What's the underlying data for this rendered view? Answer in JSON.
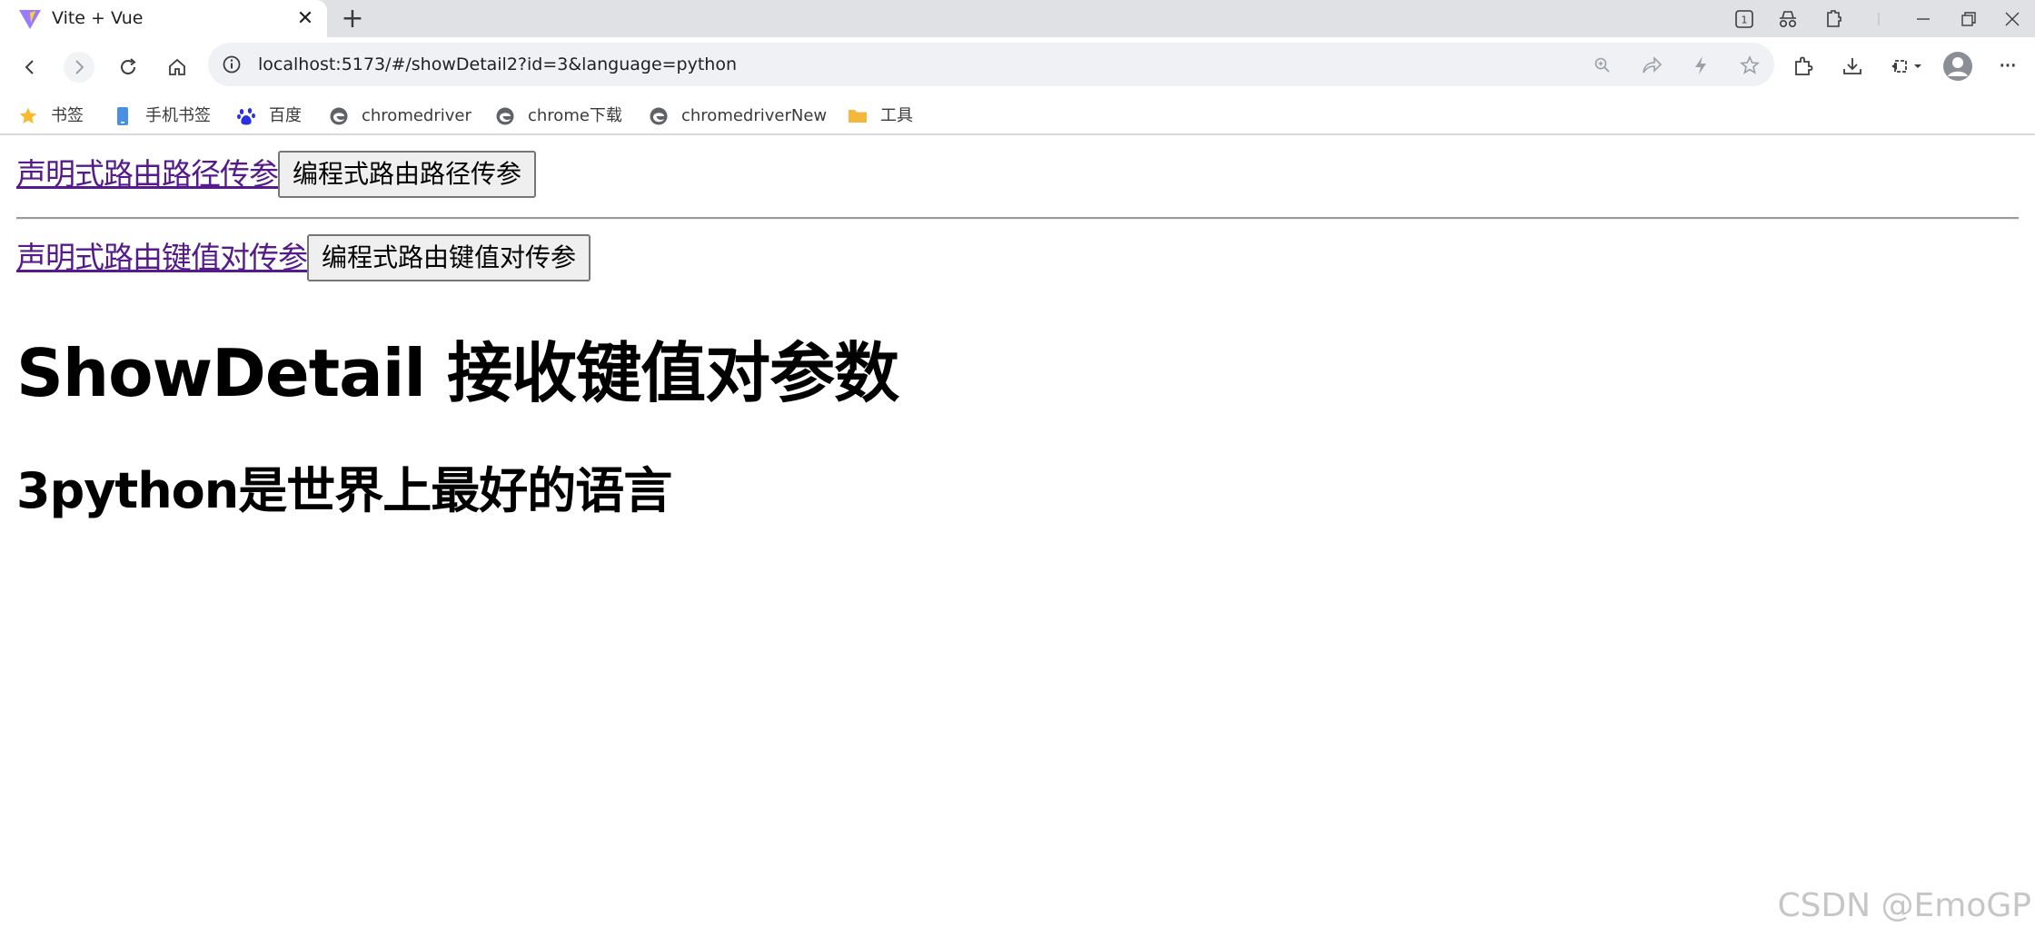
{
  "browser": {
    "tab": {
      "title": "Vite + Vue",
      "close_glyph": "✕"
    },
    "new_tab_glyph": "+",
    "window_controls": [
      "tab-count-icon",
      "incognito-icon",
      "extensions-icon",
      "minimize-icon",
      "restore-icon",
      "close-window-icon"
    ],
    "tab_count": "1",
    "url": "localhost:5173/#/showDetail2?id=3&language=python",
    "more_glyph": "···"
  },
  "bookmarks": [
    {
      "label": "书签",
      "icon": "star-icon",
      "color": "#f9bb2d"
    },
    {
      "label": "手机书签",
      "icon": "phone-icon",
      "color": "#4a90e2"
    },
    {
      "label": "百度",
      "icon": "baidu-paw-icon",
      "color": "#2932e1"
    },
    {
      "label": "chromedriver",
      "icon": "edge-icon",
      "color": "#5f6368"
    },
    {
      "label": "chrome下载",
      "icon": "edge-icon",
      "color": "#5f6368"
    },
    {
      "label": "chromedriverNew",
      "icon": "edge-icon",
      "color": "#5f6368"
    },
    {
      "label": "工具",
      "icon": "folder-icon",
      "color": "#f2b73c"
    }
  ],
  "page": {
    "row1": {
      "link": "声明式路由路径传参",
      "button": "编程式路由路径传参"
    },
    "row2": {
      "link": "声明式路由键值对传参",
      "button": "编程式路由键值对传参"
    },
    "heading": "ShowDetail 接收键值对参数",
    "detail": "3python是世界上最好的语言",
    "watermark": "CSDN @EmoGP"
  },
  "colors": {
    "visited_link": "#551a8b",
    "tabstrip_bg": "#dfe1e5",
    "omnibox_bg": "#eff1f4"
  }
}
